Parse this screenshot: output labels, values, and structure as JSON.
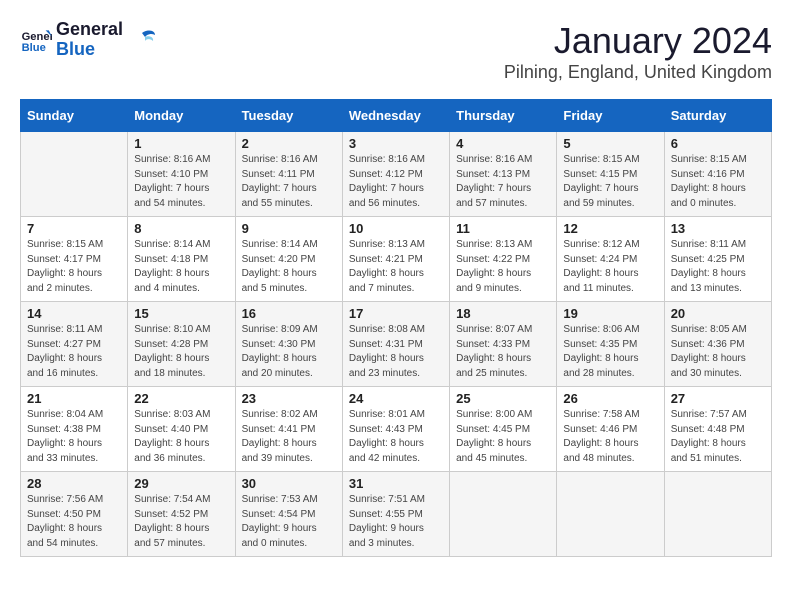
{
  "header": {
    "logo_line1": "General",
    "logo_line2": "Blue",
    "month": "January 2024",
    "location": "Pilning, England, United Kingdom"
  },
  "weekdays": [
    "Sunday",
    "Monday",
    "Tuesday",
    "Wednesday",
    "Thursday",
    "Friday",
    "Saturday"
  ],
  "weeks": [
    [
      {
        "day": "",
        "sunrise": "",
        "sunset": "",
        "daylight": ""
      },
      {
        "day": "1",
        "sunrise": "Sunrise: 8:16 AM",
        "sunset": "Sunset: 4:10 PM",
        "daylight": "Daylight: 7 hours and 54 minutes."
      },
      {
        "day": "2",
        "sunrise": "Sunrise: 8:16 AM",
        "sunset": "Sunset: 4:11 PM",
        "daylight": "Daylight: 7 hours and 55 minutes."
      },
      {
        "day": "3",
        "sunrise": "Sunrise: 8:16 AM",
        "sunset": "Sunset: 4:12 PM",
        "daylight": "Daylight: 7 hours and 56 minutes."
      },
      {
        "day": "4",
        "sunrise": "Sunrise: 8:16 AM",
        "sunset": "Sunset: 4:13 PM",
        "daylight": "Daylight: 7 hours and 57 minutes."
      },
      {
        "day": "5",
        "sunrise": "Sunrise: 8:15 AM",
        "sunset": "Sunset: 4:15 PM",
        "daylight": "Daylight: 7 hours and 59 minutes."
      },
      {
        "day": "6",
        "sunrise": "Sunrise: 8:15 AM",
        "sunset": "Sunset: 4:16 PM",
        "daylight": "Daylight: 8 hours and 0 minutes."
      }
    ],
    [
      {
        "day": "7",
        "sunrise": "Sunrise: 8:15 AM",
        "sunset": "Sunset: 4:17 PM",
        "daylight": "Daylight: 8 hours and 2 minutes."
      },
      {
        "day": "8",
        "sunrise": "Sunrise: 8:14 AM",
        "sunset": "Sunset: 4:18 PM",
        "daylight": "Daylight: 8 hours and 4 minutes."
      },
      {
        "day": "9",
        "sunrise": "Sunrise: 8:14 AM",
        "sunset": "Sunset: 4:20 PM",
        "daylight": "Daylight: 8 hours and 5 minutes."
      },
      {
        "day": "10",
        "sunrise": "Sunrise: 8:13 AM",
        "sunset": "Sunset: 4:21 PM",
        "daylight": "Daylight: 8 hours and 7 minutes."
      },
      {
        "day": "11",
        "sunrise": "Sunrise: 8:13 AM",
        "sunset": "Sunset: 4:22 PM",
        "daylight": "Daylight: 8 hours and 9 minutes."
      },
      {
        "day": "12",
        "sunrise": "Sunrise: 8:12 AM",
        "sunset": "Sunset: 4:24 PM",
        "daylight": "Daylight: 8 hours and 11 minutes."
      },
      {
        "day": "13",
        "sunrise": "Sunrise: 8:11 AM",
        "sunset": "Sunset: 4:25 PM",
        "daylight": "Daylight: 8 hours and 13 minutes."
      }
    ],
    [
      {
        "day": "14",
        "sunrise": "Sunrise: 8:11 AM",
        "sunset": "Sunset: 4:27 PM",
        "daylight": "Daylight: 8 hours and 16 minutes."
      },
      {
        "day": "15",
        "sunrise": "Sunrise: 8:10 AM",
        "sunset": "Sunset: 4:28 PM",
        "daylight": "Daylight: 8 hours and 18 minutes."
      },
      {
        "day": "16",
        "sunrise": "Sunrise: 8:09 AM",
        "sunset": "Sunset: 4:30 PM",
        "daylight": "Daylight: 8 hours and 20 minutes."
      },
      {
        "day": "17",
        "sunrise": "Sunrise: 8:08 AM",
        "sunset": "Sunset: 4:31 PM",
        "daylight": "Daylight: 8 hours and 23 minutes."
      },
      {
        "day": "18",
        "sunrise": "Sunrise: 8:07 AM",
        "sunset": "Sunset: 4:33 PM",
        "daylight": "Daylight: 8 hours and 25 minutes."
      },
      {
        "day": "19",
        "sunrise": "Sunrise: 8:06 AM",
        "sunset": "Sunset: 4:35 PM",
        "daylight": "Daylight: 8 hours and 28 minutes."
      },
      {
        "day": "20",
        "sunrise": "Sunrise: 8:05 AM",
        "sunset": "Sunset: 4:36 PM",
        "daylight": "Daylight: 8 hours and 30 minutes."
      }
    ],
    [
      {
        "day": "21",
        "sunrise": "Sunrise: 8:04 AM",
        "sunset": "Sunset: 4:38 PM",
        "daylight": "Daylight: 8 hours and 33 minutes."
      },
      {
        "day": "22",
        "sunrise": "Sunrise: 8:03 AM",
        "sunset": "Sunset: 4:40 PM",
        "daylight": "Daylight: 8 hours and 36 minutes."
      },
      {
        "day": "23",
        "sunrise": "Sunrise: 8:02 AM",
        "sunset": "Sunset: 4:41 PM",
        "daylight": "Daylight: 8 hours and 39 minutes."
      },
      {
        "day": "24",
        "sunrise": "Sunrise: 8:01 AM",
        "sunset": "Sunset: 4:43 PM",
        "daylight": "Daylight: 8 hours and 42 minutes."
      },
      {
        "day": "25",
        "sunrise": "Sunrise: 8:00 AM",
        "sunset": "Sunset: 4:45 PM",
        "daylight": "Daylight: 8 hours and 45 minutes."
      },
      {
        "day": "26",
        "sunrise": "Sunrise: 7:58 AM",
        "sunset": "Sunset: 4:46 PM",
        "daylight": "Daylight: 8 hours and 48 minutes."
      },
      {
        "day": "27",
        "sunrise": "Sunrise: 7:57 AM",
        "sunset": "Sunset: 4:48 PM",
        "daylight": "Daylight: 8 hours and 51 minutes."
      }
    ],
    [
      {
        "day": "28",
        "sunrise": "Sunrise: 7:56 AM",
        "sunset": "Sunset: 4:50 PM",
        "daylight": "Daylight: 8 hours and 54 minutes."
      },
      {
        "day": "29",
        "sunrise": "Sunrise: 7:54 AM",
        "sunset": "Sunset: 4:52 PM",
        "daylight": "Daylight: 8 hours and 57 minutes."
      },
      {
        "day": "30",
        "sunrise": "Sunrise: 7:53 AM",
        "sunset": "Sunset: 4:54 PM",
        "daylight": "Daylight: 9 hours and 0 minutes."
      },
      {
        "day": "31",
        "sunrise": "Sunrise: 7:51 AM",
        "sunset": "Sunset: 4:55 PM",
        "daylight": "Daylight: 9 hours and 3 minutes."
      },
      {
        "day": "",
        "sunrise": "",
        "sunset": "",
        "daylight": ""
      },
      {
        "day": "",
        "sunrise": "",
        "sunset": "",
        "daylight": ""
      },
      {
        "day": "",
        "sunrise": "",
        "sunset": "",
        "daylight": ""
      }
    ]
  ]
}
